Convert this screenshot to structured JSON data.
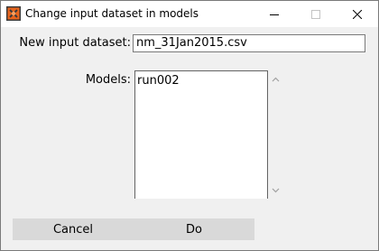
{
  "window": {
    "title": "Change input dataset in models"
  },
  "form": {
    "dataset_label": "New input dataset:",
    "dataset_value": "nm_31Jan2015.csv",
    "models_label": "Models:",
    "models": [
      "run002"
    ]
  },
  "buttons": {
    "cancel": "Cancel",
    "do": "Do"
  },
  "colors": {
    "app_icon_orange": "#e8641c",
    "button_bg": "#d9d9d9",
    "window_bg": "#f0f0f0"
  }
}
